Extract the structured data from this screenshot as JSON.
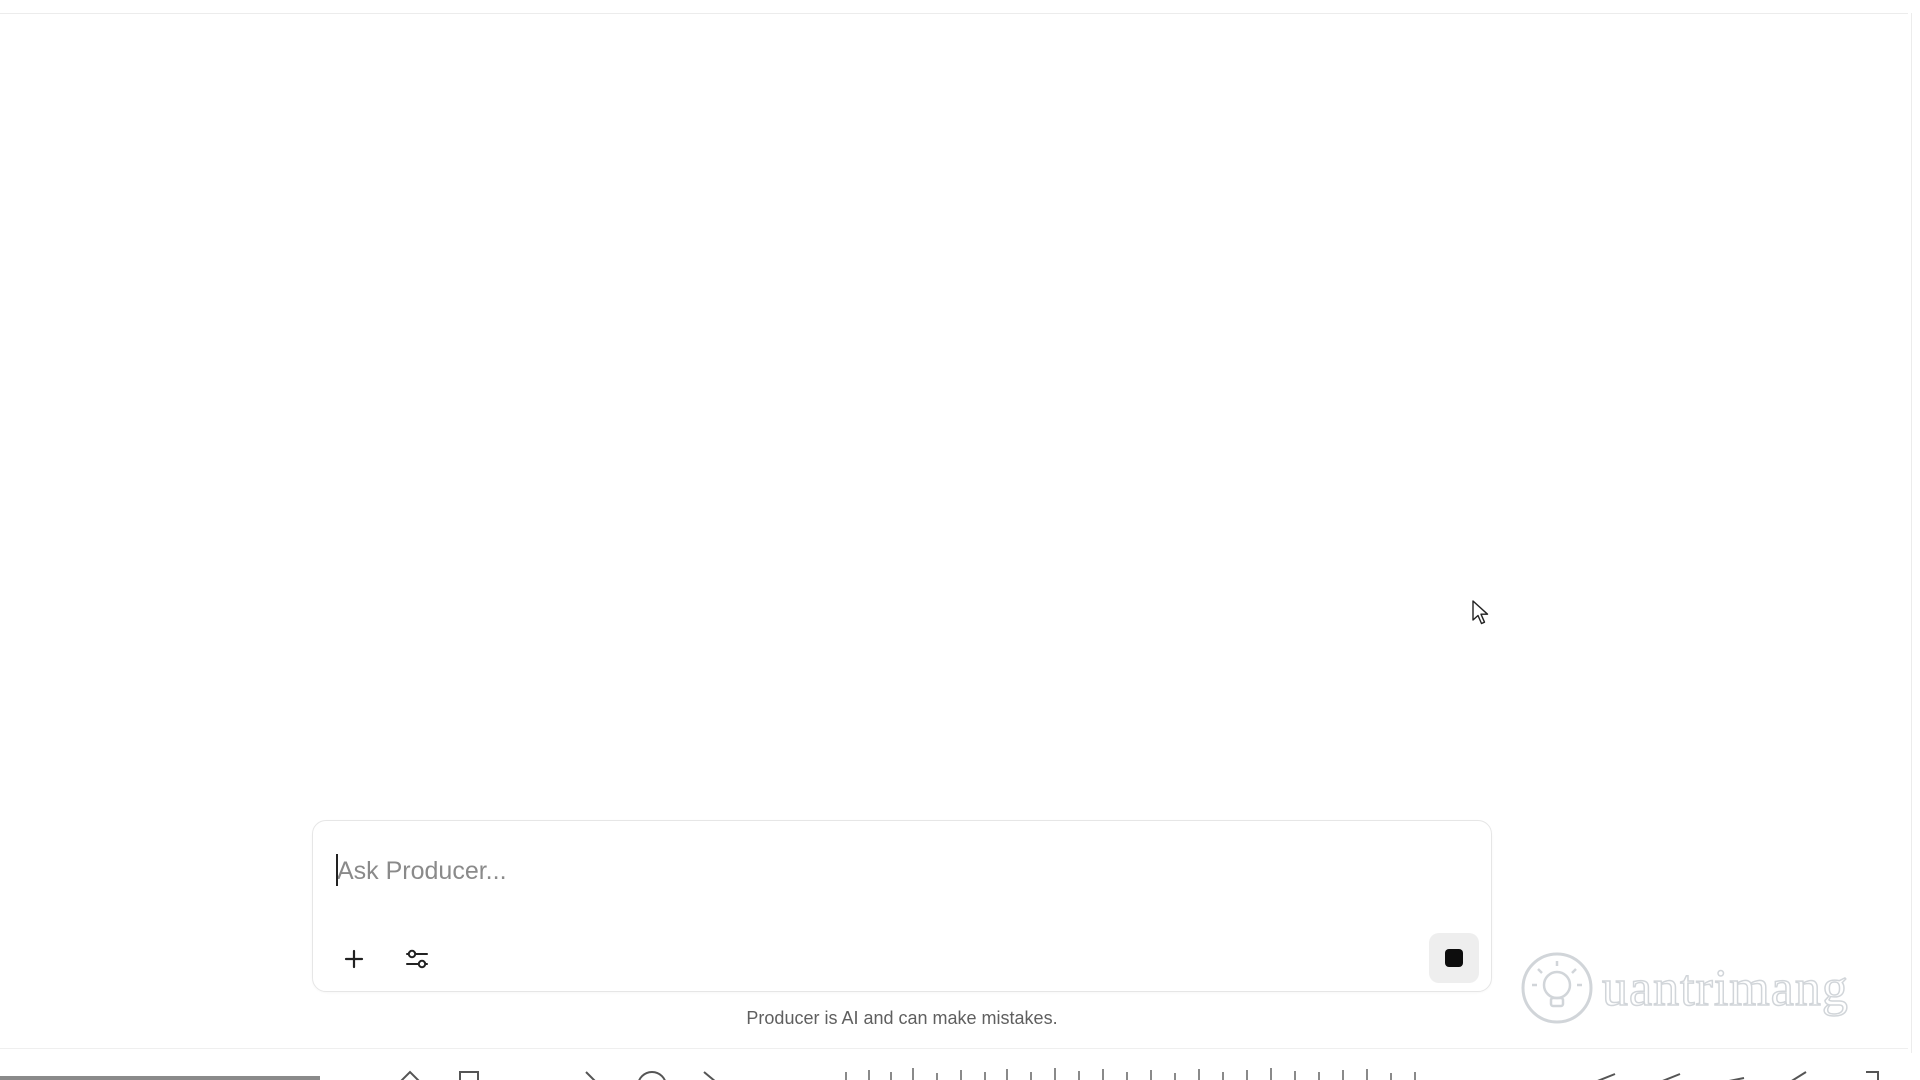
{
  "composer": {
    "placeholder": "Ask Producer...",
    "add_icon": "plus-icon",
    "settings_icon": "sliders-icon",
    "stop_icon": "stop-icon"
  },
  "footer": {
    "disclaimer": "Producer is AI and can make mistakes."
  },
  "watermark": {
    "text": "uantrimang",
    "icon": "lightbulb-icon"
  },
  "colors": {
    "background": "#ffffff",
    "border": "#e6e6e6",
    "placeholder": "#8a8a8a",
    "stop_button_bg": "#eeeeee",
    "stop_button_fg": "#0d0d0d"
  }
}
